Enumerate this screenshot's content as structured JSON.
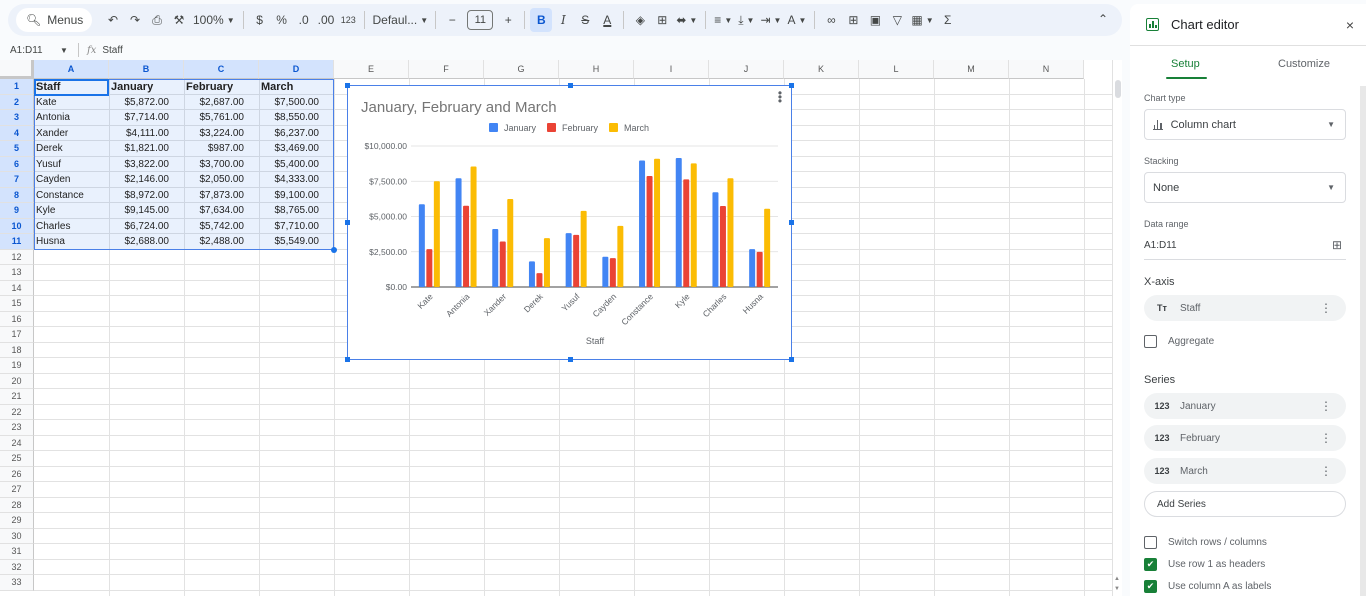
{
  "toolbar": {
    "search_label": "Menus",
    "zoom": "100%",
    "currency": "$",
    "percent": "%",
    "dec_decrease": ".0",
    "dec_increase": ".00",
    "number_format": "123",
    "font": "Defaul...",
    "font_size": "11",
    "minus": "−",
    "plus": "+",
    "bold": "B",
    "italic": "I",
    "sum": "Σ",
    "collapse": "⌃"
  },
  "formula_bar": {
    "name_box": "A1:D11",
    "fx": "fx",
    "content": "Staff"
  },
  "grid": {
    "columns": [
      "A",
      "B",
      "C",
      "D",
      "E",
      "F",
      "G",
      "H",
      "I",
      "J",
      "K",
      "L",
      "M",
      "N"
    ],
    "rows": [
      "1",
      "2",
      "3",
      "4",
      "5",
      "6",
      "7",
      "8",
      "9",
      "10",
      "11",
      "12",
      "13",
      "14",
      "15",
      "16",
      "17",
      "18",
      "19",
      "20",
      "21",
      "22",
      "23",
      "24",
      "25",
      "26",
      "27",
      "28",
      "29",
      "30",
      "31",
      "32",
      "33"
    ],
    "header": [
      "Staff",
      "January",
      "February",
      "March"
    ],
    "data": [
      [
        "Kate",
        "$5,872.00",
        "$2,687.00",
        "$7,500.00"
      ],
      [
        "Antonia",
        "$7,714.00",
        "$5,761.00",
        "$8,550.00"
      ],
      [
        "Xander",
        "$4,111.00",
        "$3,224.00",
        "$6,237.00"
      ],
      [
        "Derek",
        "$1,821.00",
        "$987.00",
        "$3,469.00"
      ],
      [
        "Yusuf",
        "$3,822.00",
        "$3,700.00",
        "$5,400.00"
      ],
      [
        "Cayden",
        "$2,146.00",
        "$2,050.00",
        "$4,333.00"
      ],
      [
        "Constance",
        "$8,972.00",
        "$7,873.00",
        "$9,100.00"
      ],
      [
        "Kyle",
        "$9,145.00",
        "$7,634.00",
        "$8,765.00"
      ],
      [
        "Charles",
        "$6,724.00",
        "$5,742.00",
        "$7,710.00"
      ],
      [
        "Husna",
        "$2,688.00",
        "$2,488.00",
        "$5,549.00"
      ]
    ]
  },
  "chart_data": {
    "type": "bar",
    "title": "January, February and March",
    "xlabel": "Staff",
    "ylabel": "",
    "categories": [
      "Kate",
      "Antonia",
      "Xander",
      "Derek",
      "Yusuf",
      "Cayden",
      "Constance",
      "Kyle",
      "Charles",
      "Husna"
    ],
    "series": [
      {
        "name": "January",
        "color": "#4285f4",
        "values": [
          5872,
          7714,
          4111,
          1821,
          3822,
          2146,
          8972,
          9145,
          6724,
          2688
        ]
      },
      {
        "name": "February",
        "color": "#ea4335",
        "values": [
          2687,
          5761,
          3224,
          987,
          3700,
          2050,
          7873,
          7634,
          5742,
          2488
        ]
      },
      {
        "name": "March",
        "color": "#fbbc04",
        "values": [
          7500,
          8550,
          6237,
          3469,
          5400,
          4333,
          9100,
          8765,
          7710,
          5549
        ]
      }
    ],
    "ylim": [
      0,
      10000
    ],
    "yticks": [
      0,
      2500,
      5000,
      7500,
      10000
    ],
    "ytick_labels": [
      "$0.00",
      "$2,500.00",
      "$5,000.00",
      "$7,500.00",
      "$10,000.00"
    ],
    "grid": true,
    "legend": "top"
  },
  "panel": {
    "title": "Chart editor",
    "close": "×",
    "tabs": [
      "Setup",
      "Customize"
    ],
    "chart_type_label": "Chart type",
    "chart_type_value": "Column chart",
    "stacking_label": "Stacking",
    "stacking_value": "None",
    "data_range_label": "Data range",
    "data_range_value": "A1:D11",
    "xaxis_label": "X-axis",
    "xaxis_value": "Staff",
    "xaxis_prefix": "Tт",
    "aggregate_label": "Aggregate",
    "series_label": "Series",
    "series": [
      {
        "prefix": "123",
        "name": "January"
      },
      {
        "prefix": "123",
        "name": "February"
      },
      {
        "prefix": "123",
        "name": "March"
      }
    ],
    "add_series": "Add Series",
    "options": [
      {
        "label": "Switch rows / columns",
        "checked": false
      },
      {
        "label": "Use row 1 as headers",
        "checked": true
      },
      {
        "label": "Use column A as labels",
        "checked": true
      }
    ]
  }
}
